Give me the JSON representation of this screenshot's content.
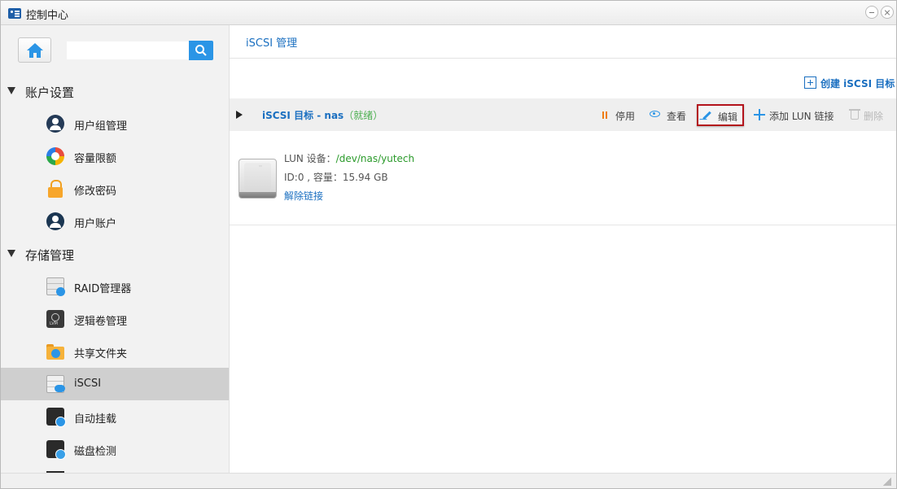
{
  "window": {
    "title": "控制中心"
  },
  "sidebar": {
    "search": {
      "value": "",
      "placeholder": ""
    },
    "groups": [
      {
        "label": "账户设置",
        "items": [
          {
            "label": "用户组管理",
            "icon": "user-group-icon"
          },
          {
            "label": "容量限额",
            "icon": "quota-icon"
          },
          {
            "label": "修改密码",
            "icon": "lock-icon"
          },
          {
            "label": "用户账户",
            "icon": "user-account-icon"
          }
        ]
      },
      {
        "label": "存储管理",
        "items": [
          {
            "label": "RAID管理器",
            "icon": "raid-icon"
          },
          {
            "label": "逻辑卷管理",
            "icon": "lvm-icon"
          },
          {
            "label": "共享文件夹",
            "icon": "shared-folder-icon"
          },
          {
            "label": "iSCSI",
            "icon": "iscsi-icon",
            "active": true
          },
          {
            "label": "自动挂载",
            "icon": "auto-mount-icon"
          },
          {
            "label": "磁盘检测",
            "icon": "disk-check-icon"
          }
        ]
      }
    ]
  },
  "main": {
    "title": "iSCSI 管理",
    "create_label": "创建 iSCSI 目标",
    "target": {
      "name": "iSCSI 目标 - nas",
      "status": "（就绪）",
      "actions": {
        "stop": "停用",
        "view": "查看",
        "edit": "编辑",
        "add_lun": "添加 LUN 链接",
        "delete": "删除"
      }
    },
    "lun": {
      "device_label": "LUN 设备：",
      "device_path": "/dev/nas/yutech",
      "info": "ID:0 , 容量：15.94 GB",
      "unlink": "解除链接"
    }
  },
  "colors": {
    "accent": "#1a6fc0",
    "search_button": "#2b95e6",
    "ready_status": "#4caf50",
    "path": "#2a9a2a",
    "highlight_border": "#b3131b",
    "stop_icon": "#ef7d12"
  }
}
